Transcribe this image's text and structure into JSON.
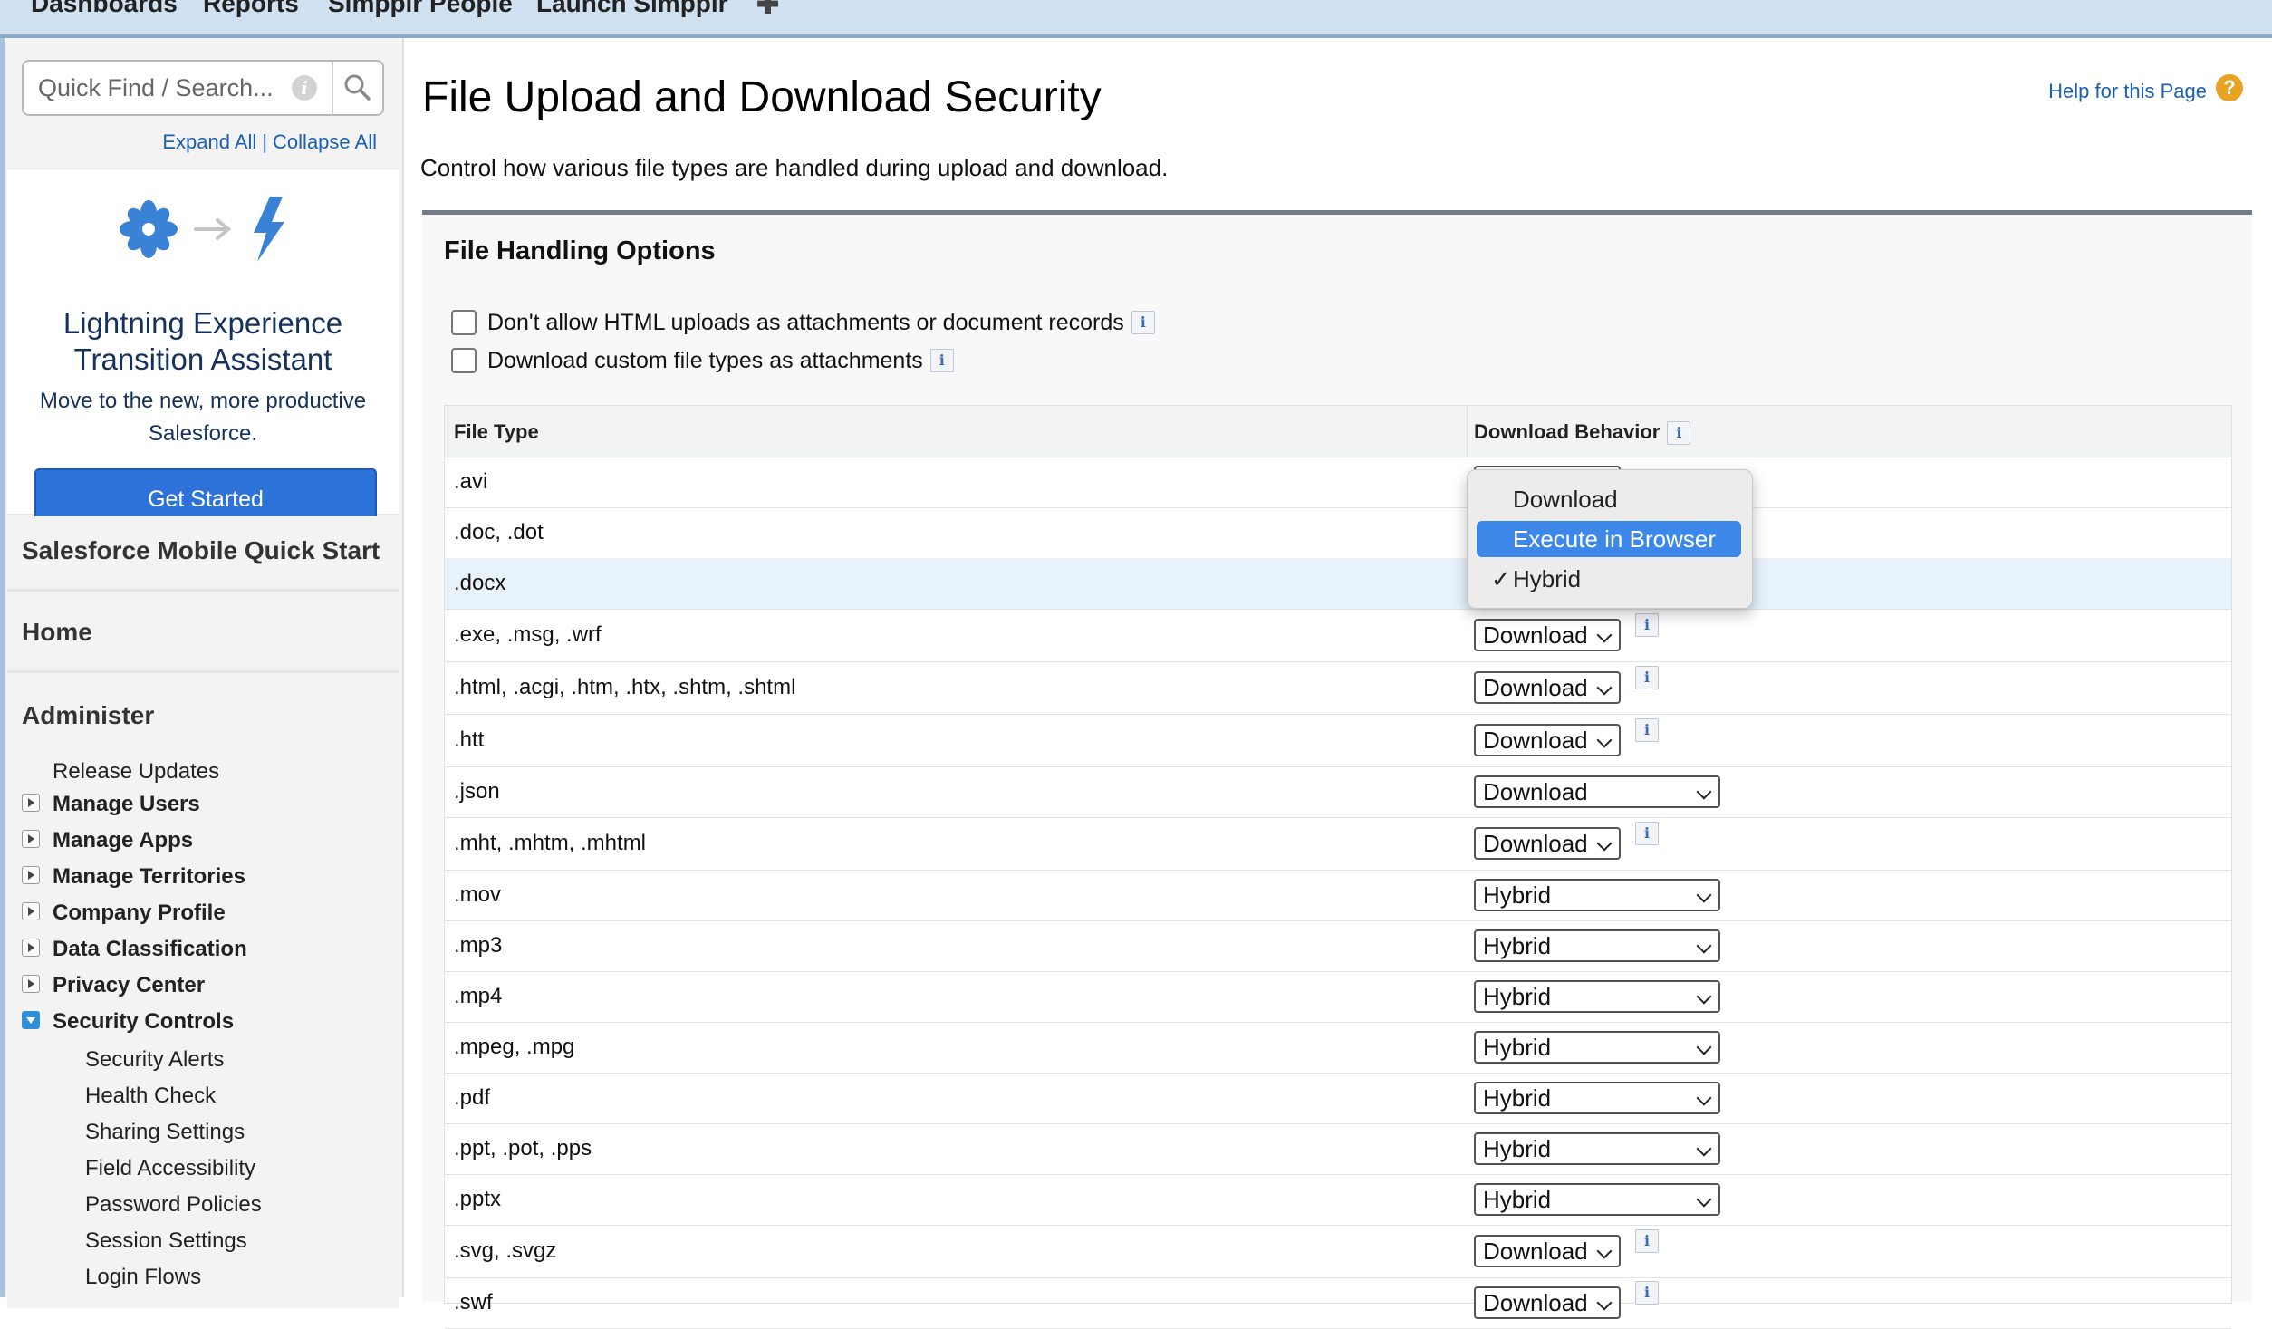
{
  "topnav": {
    "tabs": [
      "Dashboards",
      "Reports",
      "Simpplr People",
      "Launch Simpplr"
    ],
    "add_tab_icon": "plus-icon"
  },
  "sidebar": {
    "search_placeholder": "Quick Find / Search...",
    "expand_all": "Expand All",
    "separator": "|",
    "collapse_all": "Collapse All",
    "lightning": {
      "title_line1": "Lightning Experience",
      "title_line2": "Transition Assistant",
      "sub_line1": "Move to the new, more productive",
      "sub_line2": "Salesforce.",
      "button": "Get Started"
    },
    "mobile_quick_start": "Salesforce Mobile Quick Start",
    "home": "Home",
    "administer": "Administer",
    "admin_items": [
      {
        "label": "Release Updates",
        "expandable": false
      },
      {
        "label": "Manage Users",
        "expandable": true
      },
      {
        "label": "Manage Apps",
        "expandable": true
      },
      {
        "label": "Manage Territories",
        "expandable": true
      },
      {
        "label": "Company Profile",
        "expandable": true
      },
      {
        "label": "Data Classification",
        "expandable": true
      },
      {
        "label": "Privacy Center",
        "expandable": true
      },
      {
        "label": "Security Controls",
        "expandable": true,
        "open": true
      }
    ],
    "security_children": [
      "Security Alerts",
      "Health Check",
      "Sharing Settings",
      "Field Accessibility",
      "Password Policies",
      "Session Settings",
      "Login Flows"
    ]
  },
  "main": {
    "title": "File Upload and Download Security",
    "help_link": "Help for this Page",
    "help_icon_glyph": "?",
    "description": "Control how various file types are handled during upload and download.",
    "panel_title": "File Handling Options",
    "options": [
      {
        "label": "Don't allow HTML uploads as attachments or document records",
        "checked": false
      },
      {
        "label": "Download custom file types as attachments",
        "checked": false
      }
    ],
    "info_glyph": "i",
    "table": {
      "col_file_type": "File Type",
      "col_download_behavior": "Download Behavior",
      "rows": [
        {
          "type": ".avi",
          "value": "Hybrid",
          "style": "short",
          "info": false
        },
        {
          "type": ".doc, .dot",
          "value": "Hybrid",
          "style": "short",
          "info": false
        },
        {
          "type": ".docx",
          "value": "Hybrid",
          "style": "short",
          "info": false,
          "highlight": true
        },
        {
          "type": ".exe, .msg, .wrf",
          "value": "Download",
          "style": "short",
          "info": true
        },
        {
          "type": ".html, .acgi, .htm, .htx, .shtm, .shtml",
          "value": "Download",
          "style": "short",
          "info": true
        },
        {
          "type": ".htt",
          "value": "Download",
          "style": "short",
          "info": true
        },
        {
          "type": ".json",
          "value": "Download",
          "style": "long",
          "info": false
        },
        {
          "type": ".mht, .mhtm, .mhtml",
          "value": "Download",
          "style": "short",
          "info": true
        },
        {
          "type": ".mov",
          "value": "Hybrid",
          "style": "long",
          "info": false
        },
        {
          "type": ".mp3",
          "value": "Hybrid",
          "style": "long",
          "info": false
        },
        {
          "type": ".mp4",
          "value": "Hybrid",
          "style": "long",
          "info": false
        },
        {
          "type": ".mpeg, .mpg",
          "value": "Hybrid",
          "style": "long",
          "info": false
        },
        {
          "type": ".pdf",
          "value": "Hybrid",
          "style": "long",
          "info": false
        },
        {
          "type": ".ppt, .pot, .pps",
          "value": "Hybrid",
          "style": "long",
          "info": false
        },
        {
          "type": ".pptx",
          "value": "Hybrid",
          "style": "long",
          "info": false
        },
        {
          "type": ".svg, .svgz",
          "value": "Download",
          "style": "short",
          "info": true
        },
        {
          "type": ".swf",
          "value": "Download",
          "style": "short",
          "info": true
        }
      ]
    },
    "dropdown_popup": {
      "options": [
        "Download",
        "Execute in Browser",
        "Hybrid"
      ],
      "highlighted": "Execute in Browser",
      "selected": "Hybrid",
      "check_glyph": "✓"
    }
  },
  "colors": {
    "accent": "#2d72d9",
    "link": "#1a5fb4",
    "popup_highlight": "#3d87e8",
    "row_highlight": "#e8f2fb"
  }
}
